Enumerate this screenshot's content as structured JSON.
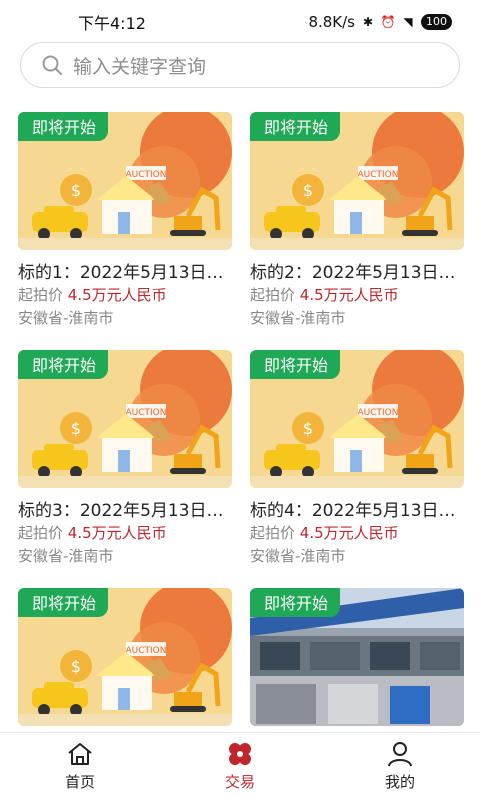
{
  "status_bar": {
    "time": "下午4:12",
    "network_speed": "8.8K/s",
    "battery": "100"
  },
  "search": {
    "placeholder": "输入关键字查询"
  },
  "listings": [
    {
      "badge": "即将开始",
      "title": "标的1：2022年5月13日…",
      "price_label": "起拍价",
      "price_value": "4.5万元人民币",
      "location": "安徽省-淮南市",
      "image": "auction-illustration"
    },
    {
      "badge": "即将开始",
      "title": "标的2：2022年5月13日…",
      "price_label": "起拍价",
      "price_value": "4.5万元人民币",
      "location": "安徽省-淮南市",
      "image": "auction-illustration"
    },
    {
      "badge": "即将开始",
      "title": "标的3：2022年5月13日…",
      "price_label": "起拍价",
      "price_value": "4.5万元人民币",
      "location": "安徽省-淮南市",
      "image": "auction-illustration"
    },
    {
      "badge": "即将开始",
      "title": "标的4：2022年5月13日…",
      "price_label": "起拍价",
      "price_value": "4.5万元人民币",
      "location": "安徽省-淮南市",
      "image": "auction-illustration"
    },
    {
      "badge": "即将开始",
      "image": "auction-illustration"
    },
    {
      "badge": "即将开始",
      "image": "storefront-photo"
    }
  ],
  "illustration_text": "AUCTION",
  "bottom_nav": [
    {
      "label": "首页",
      "icon": "home-icon",
      "active": false
    },
    {
      "label": "交易",
      "icon": "clover-icon",
      "active": true
    },
    {
      "label": "我的",
      "icon": "user-icon",
      "active": false
    }
  ],
  "colors": {
    "accent": "#c0272d",
    "badge": "#1fa855",
    "muted": "#888888"
  }
}
